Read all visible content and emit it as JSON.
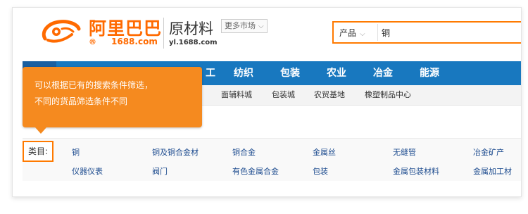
{
  "header": {
    "logo_cn": "阿里巴巴",
    "logo_reg": "®",
    "logo_domain": "1688.com",
    "market_name": "原材料",
    "market_domain": "yl.1688.com",
    "more_markets": "更多市场"
  },
  "search": {
    "category": "产品",
    "value": "铜"
  },
  "nav": {
    "items": [
      "纺织",
      "包装",
      "农业",
      "冶金",
      "能源"
    ],
    "partial": "工"
  },
  "subnav": {
    "items": [
      "面辅料城",
      "包装城",
      "农贸基地",
      "橡塑制品中心"
    ]
  },
  "category": {
    "label": "类目:",
    "row1": [
      "铜",
      "铜及铜合金材",
      "铜合金",
      "金属丝",
      "无缝管",
      "冶金矿产"
    ],
    "row2": [
      "仪器仪表",
      "阀门",
      "有色金属合金",
      "包装",
      "金属包装材料",
      "金属加工材"
    ]
  },
  "tooltip": {
    "line1": "可以根据已有的搜索条件筛选，",
    "line2": "不同的货品筛选条件不同"
  },
  "colors": {
    "brand_orange": "#ff6a00",
    "nav_blue": "#1878bf",
    "tooltip_orange": "#f58a1f",
    "link_blue": "#1b4a8e"
  }
}
